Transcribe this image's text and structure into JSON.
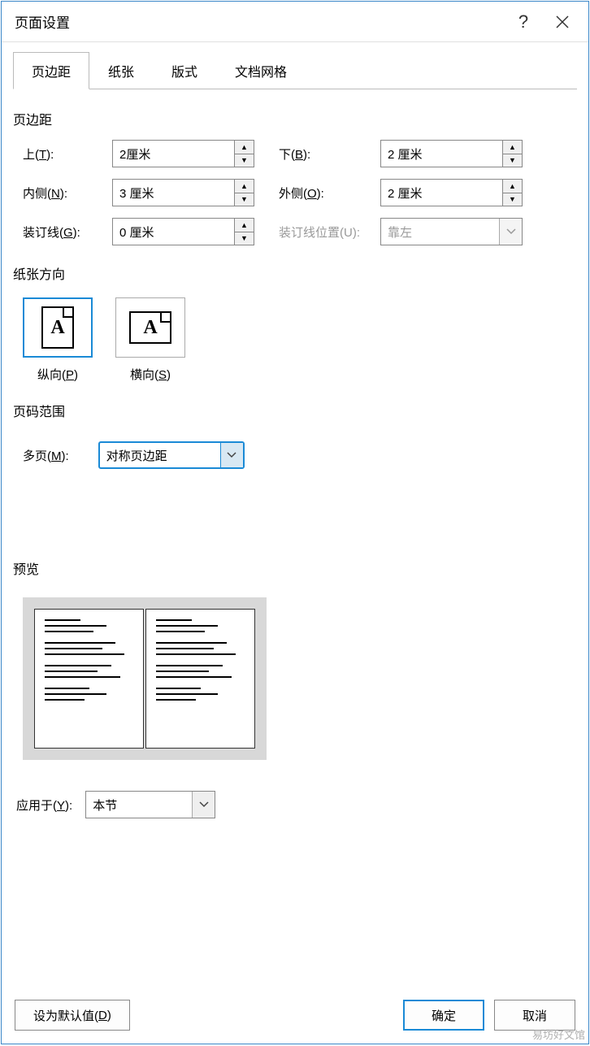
{
  "dialog": {
    "title": "页面设置"
  },
  "tabs": [
    "页边距",
    "纸张",
    "版式",
    "文档网格"
  ],
  "sections": {
    "margins": "页边距",
    "orientation": "纸张方向",
    "pages": "页码范围",
    "preview": "预览"
  },
  "margins": {
    "top_label": "上(T):",
    "top_value": "2厘米",
    "bottom_label": "下(B):",
    "bottom_value": "2 厘米",
    "inside_label": "内侧(N):",
    "inside_value": "3 厘米",
    "outside_label": "外侧(O):",
    "outside_value": "2 厘米",
    "gutter_label": "装订线(G):",
    "gutter_value": "0 厘米",
    "gutter_pos_label": "装订线位置(U):",
    "gutter_pos_value": "靠左"
  },
  "orientation": {
    "portrait": "纵向(P)",
    "landscape": "横向(S)",
    "selected": "portrait"
  },
  "pages": {
    "multi_label": "多页(M):",
    "multi_value": "对称页边距"
  },
  "apply": {
    "label": "应用于(Y):",
    "value": "本节"
  },
  "buttons": {
    "default": "设为默认值(D)",
    "ok": "确定",
    "cancel": "取消"
  },
  "watermark": "易坊好文馆"
}
